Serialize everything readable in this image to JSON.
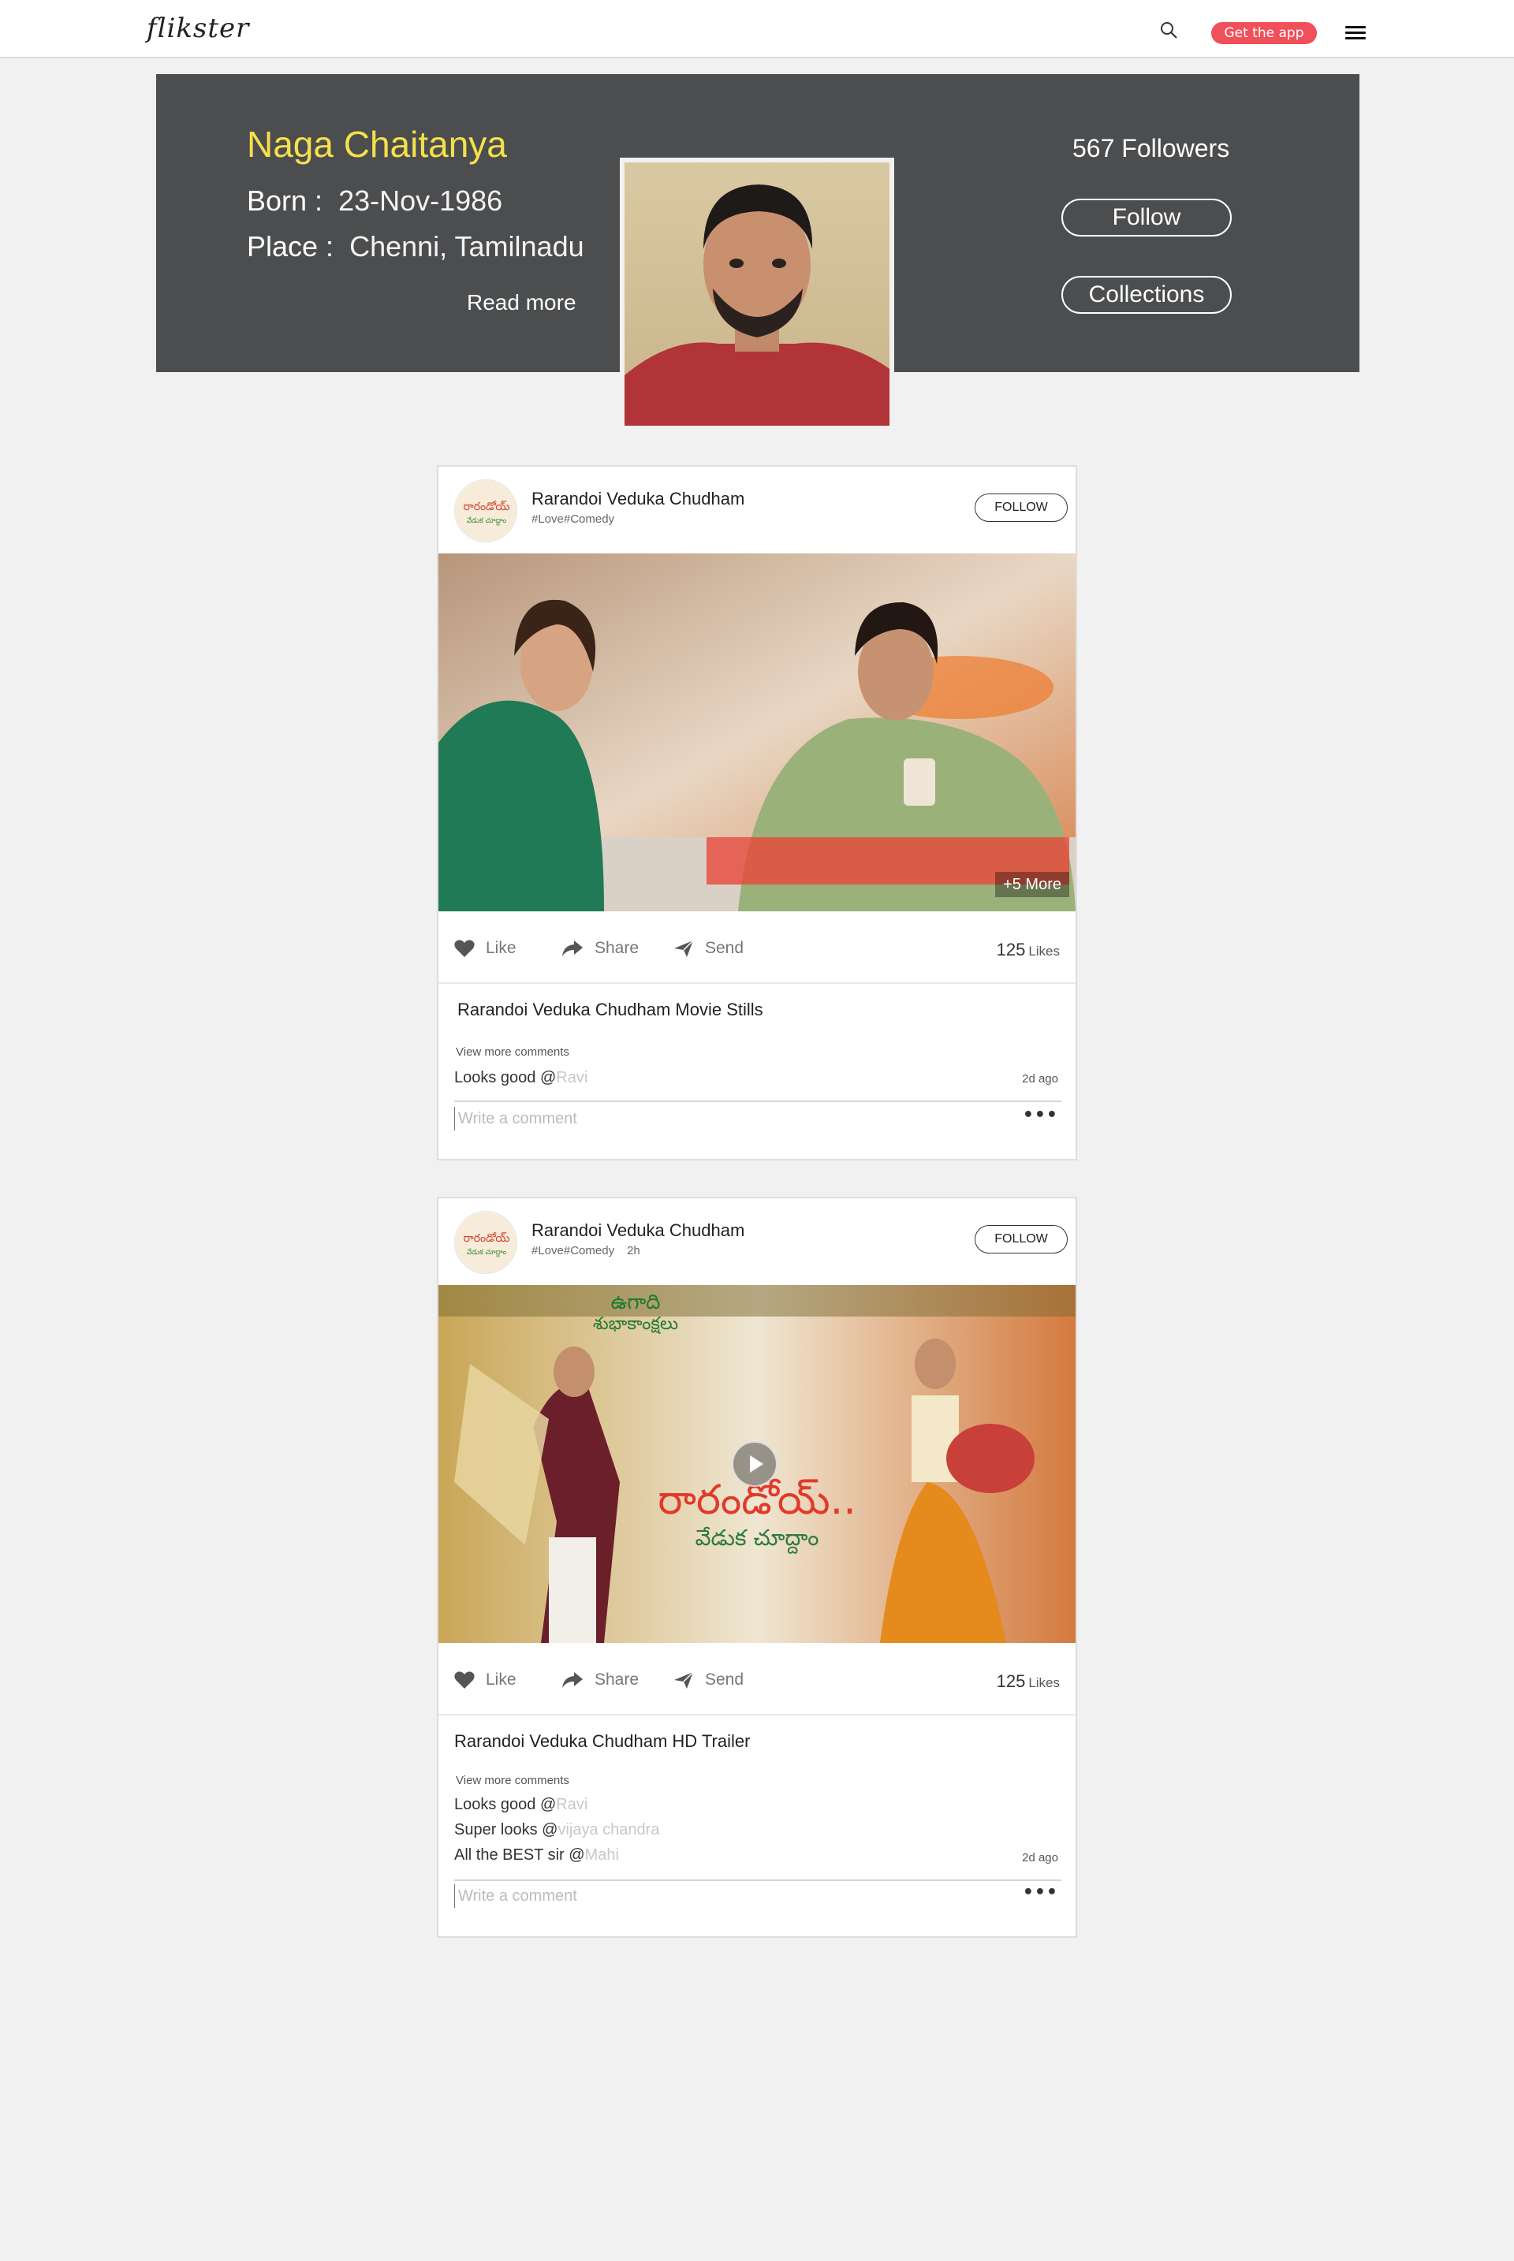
{
  "header": {
    "logo": "flikster",
    "get_app_label": "Get the app"
  },
  "profile": {
    "name": "Naga Chaitanya",
    "born_label": "Born :",
    "born_value": "23-Nov-1986",
    "place_label": "Place :",
    "place_value": "Chenni, Tamilnadu",
    "read_more": "Read more",
    "followers": "567 Followers",
    "follow_label": "Follow",
    "collections_label": "Collections"
  },
  "posts": [
    {
      "title": "Rarandoi Veduka Chudham",
      "tags": "#Love#Comedy",
      "time": "",
      "follow_label": "FOLLOW",
      "more_badge": "+5 More",
      "like_label": "Like",
      "share_label": "Share",
      "send_label": "Send",
      "likes_count": "125",
      "likes_word": "Likes",
      "caption": "Rarandoi Veduka Chudham Movie Stills",
      "view_more": "View more comments",
      "comments": [
        {
          "text": "Looks good @",
          "user": "Ravi"
        }
      ],
      "ago": "2d ago",
      "comment_placeholder": "Write a comment"
    },
    {
      "title": "Rarandoi Veduka Chudham",
      "tags": "#Love#Comedy",
      "time": "2h",
      "follow_label": "FOLLOW",
      "like_label": "Like",
      "share_label": "Share",
      "send_label": "Send",
      "likes_count": "125",
      "likes_word": "Likes",
      "caption": "Rarandoi Veduka Chudham HD Trailer",
      "view_more": "View more comments",
      "comments": [
        {
          "text": "Looks good @",
          "user": "Ravi"
        },
        {
          "text": "Super looks @",
          "user": "vijaya chandra"
        },
        {
          "text": "All the BEST sir @",
          "user": "Mahi"
        }
      ],
      "ago": "2d ago",
      "comment_placeholder": "Write a comment"
    }
  ],
  "colors": {
    "accent": "#f0505a",
    "name_yellow": "#f5e04a",
    "banner": "#4b4d4f"
  }
}
